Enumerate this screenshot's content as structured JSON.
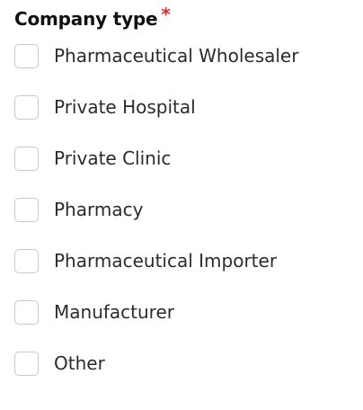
{
  "form": {
    "field_label": "Company type",
    "required_marker": "*",
    "options": [
      {
        "label": "Pharmaceutical Wholesaler",
        "checked": false
      },
      {
        "label": "Private Hospital",
        "checked": false
      },
      {
        "label": "Private Clinic",
        "checked": false
      },
      {
        "label": "Pharmacy",
        "checked": false
      },
      {
        "label": "Pharmaceutical Importer",
        "checked": false
      },
      {
        "label": "Manufacturer",
        "checked": false
      },
      {
        "label": "Other",
        "checked": false
      }
    ]
  },
  "colors": {
    "required": "#d32f2f",
    "checkbox_border": "#c9c9c9",
    "text": "#2b2b2b"
  }
}
